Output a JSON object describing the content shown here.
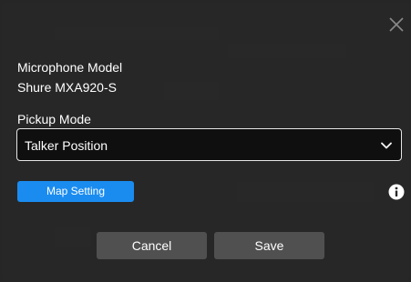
{
  "dialog": {
    "microphone_model_label": "Microphone Model",
    "microphone_model_value": "Shure MXA920-S",
    "pickup_mode_label": "Pickup Mode",
    "pickup_mode_selected": "Talker Position",
    "map_setting_label": "Map Setting",
    "cancel_label": "Cancel",
    "save_label": "Save"
  },
  "icons": {
    "close": "close-icon",
    "chevron": "chevron-down-icon",
    "info": "info-icon"
  },
  "colors": {
    "dialog_bg": "#282828",
    "select_bg": "#0f0f0f",
    "accent": "#1a8cf0",
    "button_bg": "#505050",
    "text": "#ffffff"
  }
}
